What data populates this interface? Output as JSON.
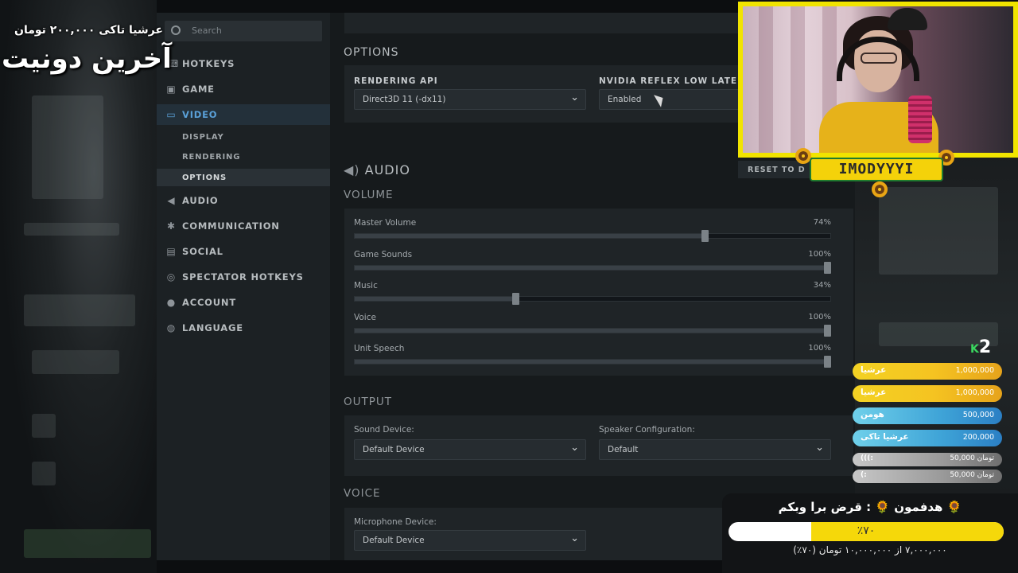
{
  "sidebar": {
    "search_placeholder": "Search",
    "items": [
      {
        "label": "HOTKEYS",
        "icon": "keyboard-icon"
      },
      {
        "label": "GAME",
        "icon": "game-icon"
      },
      {
        "label": "VIDEO",
        "icon": "monitor-icon"
      },
      {
        "label": "AUDIO",
        "icon": "speaker-icon"
      },
      {
        "label": "COMMUNICATION",
        "icon": "gear-icon"
      },
      {
        "label": "SOCIAL",
        "icon": "chat-icon"
      },
      {
        "label": "SPECTATOR HOTKEYS",
        "icon": "camera-icon"
      },
      {
        "label": "ACCOUNT",
        "icon": "person-icon"
      },
      {
        "label": "LANGUAGE",
        "icon": "globe-icon"
      }
    ],
    "video_sub": [
      "DISPLAY",
      "RENDERING",
      "OPTIONS"
    ],
    "active": "VIDEO",
    "active_sub": "OPTIONS"
  },
  "options": {
    "title": "OPTIONS",
    "rendering_api_label": "RENDERING API",
    "rendering_api_value": "Direct3D 11 (-dx11)",
    "reflex_label": "NVIDIA REFLEX LOW LATENC",
    "reflex_value": "Enabled"
  },
  "audio": {
    "title": "AUDIO",
    "reset_label": "RESET TO D",
    "volume_title": "VOLUME",
    "sliders": [
      {
        "name": "Master Volume",
        "value": 74,
        "display": "74%"
      },
      {
        "name": "Game Sounds",
        "value": 100,
        "display": "100%"
      },
      {
        "name": "Music",
        "value": 34,
        "display": "34%"
      },
      {
        "name": "Voice",
        "value": 100,
        "display": "100%"
      },
      {
        "name": "Unit Speech",
        "value": 100,
        "display": "100%"
      }
    ],
    "output_title": "OUTPUT",
    "sound_device_label": "Sound Device:",
    "sound_device_value": "Default Device",
    "speaker_config_label": "Speaker Configuration:",
    "speaker_config_value": "Default",
    "voice_title": "VOICE",
    "mic_label": "Microphone Device:",
    "mic_value": "Default Device"
  },
  "overlay": {
    "last_donor_line": "عرشیا تاکی ۲۰۰,۰۰۰ تومان",
    "last_donate_title": "آخرین دونیت",
    "streamer_name": "IMODYYYI",
    "k2_k": "K",
    "k2_num": "2",
    "leaderboard": [
      {
        "name": "عرشیا",
        "amount": "1,000,000",
        "tier": "gold"
      },
      {
        "name": "عرشیا",
        "amount": "1,000,000",
        "tier": "gold"
      },
      {
        "name": "هومن",
        "amount": "500,000",
        "tier": "blue"
      },
      {
        "name": "عرشیا تاکی",
        "amount": "200,000",
        "tier": "blue"
      },
      {
        "name": ":)))",
        "amount": "50,000 تومان",
        "tier": "gray"
      },
      {
        "name": ":)",
        "amount": "50,000 تومان",
        "tier": "gray"
      }
    ],
    "goal": {
      "title": "🌻 هدفمون 🌻 : قرض برا وبکم",
      "percent_label": "٪۷۰",
      "progress": 0.7,
      "subtitle": "۷,۰۰۰,۰۰۰ از ۱۰,۰۰۰,۰۰۰ تومان (۷۰٪)"
    }
  },
  "colors": {
    "accent_blue": "#5aa0d8",
    "webcam_border": "#f1e400",
    "goal_fill": "#f5d80a"
  }
}
